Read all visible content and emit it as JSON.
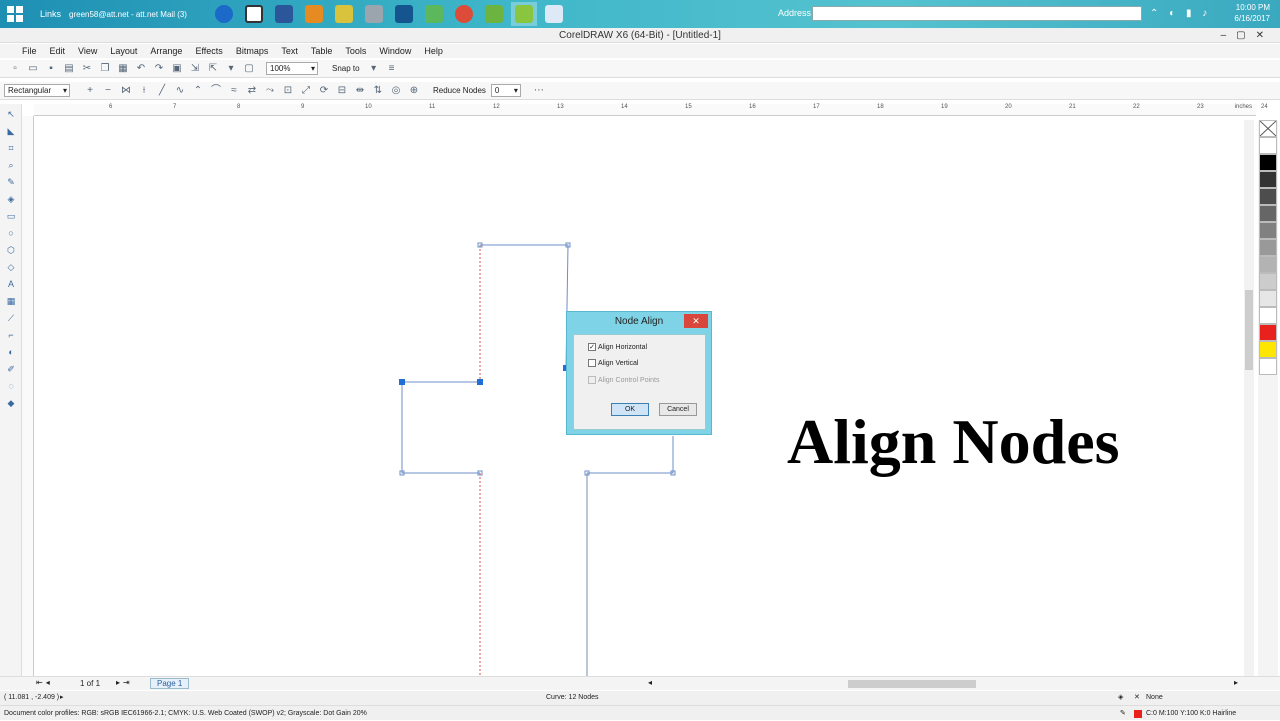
{
  "taskbar": {
    "links_label": "Links",
    "mail_label": "green58@att.net - att.net Mail (3)",
    "address_label": "Address",
    "clock_time": "10:00 PM",
    "clock_date": "6/16/2017"
  },
  "window": {
    "title": "CorelDRAW X6 (64-Bit) - [Untitled-1]"
  },
  "menu": [
    "File",
    "Edit",
    "View",
    "Layout",
    "Arrange",
    "Effects",
    "Bitmaps",
    "Text",
    "Table",
    "Tools",
    "Window",
    "Help"
  ],
  "toolbar": {
    "zoom": "100%",
    "snap_to": "Snap to"
  },
  "property_bar": {
    "selection_mode": "Rectangular",
    "reduce_nodes_label": "Reduce Nodes",
    "reduce_nodes_value": "0"
  },
  "ruler": {
    "ticks": [
      "6",
      "7",
      "8",
      "9",
      "10",
      "11",
      "12",
      "13",
      "14",
      "15",
      "16",
      "17",
      "18",
      "19",
      "20",
      "21",
      "22",
      "23",
      "24"
    ],
    "units": "inches"
  },
  "canvas": {
    "title_text": "Align Nodes"
  },
  "dialog": {
    "title": "Node Align",
    "close": "✕",
    "align_horizontal": {
      "label": "Align Horizontal",
      "checked": true
    },
    "align_vertical": {
      "label": "Align Vertical",
      "checked": false
    },
    "align_control_points": {
      "label": "Align Control Points",
      "enabled": false
    },
    "ok_label": "OK",
    "cancel_label": "Cancel"
  },
  "pagebar": {
    "page_count": "1 of 1",
    "page_tab": "Page 1"
  },
  "status": {
    "coords": "( 11.081 , -2.409 )",
    "curve_info": "Curve: 12 Nodes",
    "fill": "None",
    "color_profiles": "Document color profiles: RGB: sRGB IEC61966-2.1; CMYK: U.S. Web Coated (SWOP) v2; Grayscale: Dot Gain 20%",
    "outline": "C:0 M:100 Y:100 K:0  Hairline"
  },
  "palette_colors": [
    "#ffffff",
    "#000000",
    "#333333",
    "#4d4d4d",
    "#666666",
    "#808080",
    "#999999",
    "#b3b3b3",
    "#cccccc",
    "#e6e6e6",
    "#ffffff",
    "#e8211d",
    "#ffe600",
    "#ffffff"
  ]
}
